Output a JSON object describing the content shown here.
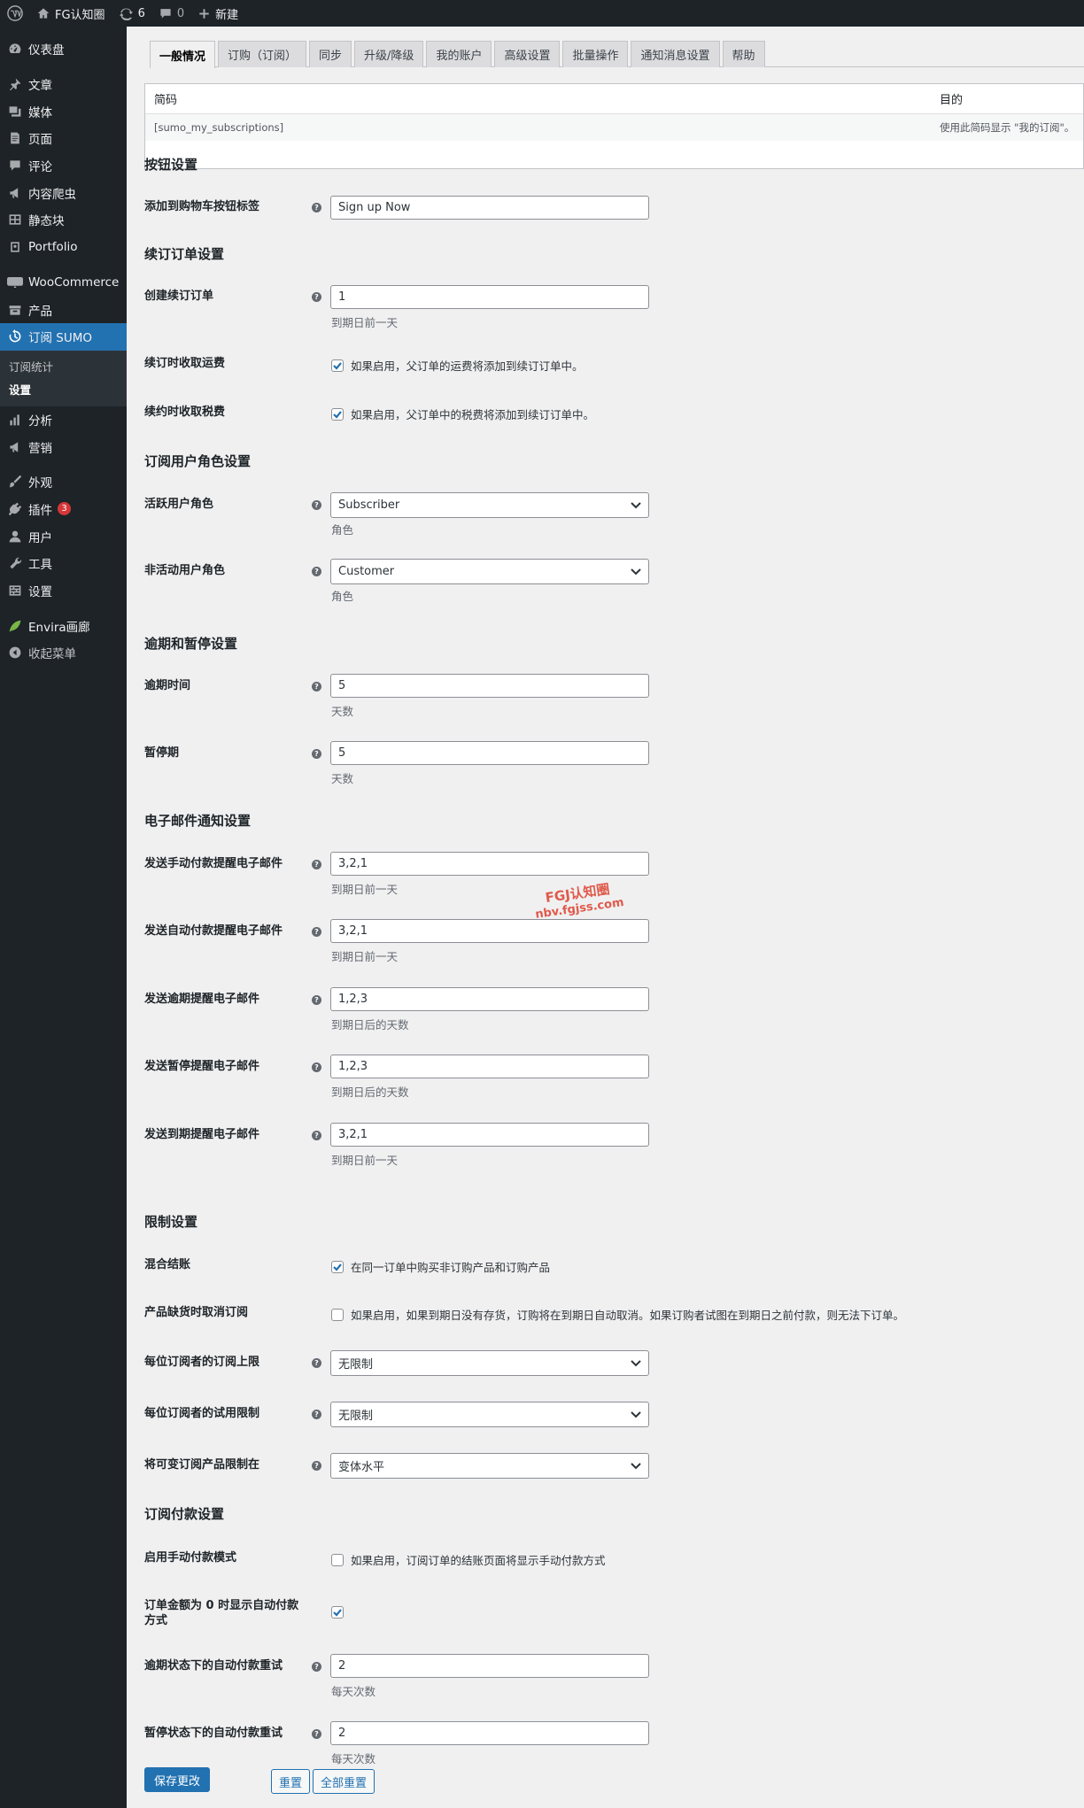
{
  "adminbar": {
    "site_name": "FG认知圈",
    "updates_count": "6",
    "comments_count": "0",
    "new_label": "新建"
  },
  "sidebar": {
    "items": [
      {
        "label": "仪表盘",
        "icon": "dashboard-icon"
      },
      {
        "label": "文章",
        "icon": "pin-icon"
      },
      {
        "label": "媒体",
        "icon": "media-icon"
      },
      {
        "label": "页面",
        "icon": "page-icon"
      },
      {
        "label": "评论",
        "icon": "comment-icon"
      },
      {
        "label": "内容爬虫",
        "icon": "megaphone-icon"
      },
      {
        "label": "静态块",
        "icon": "grid-icon"
      },
      {
        "label": "Portfolio",
        "icon": "portfolio-icon"
      },
      {
        "label": "WooCommerce",
        "icon": "woo-icon"
      },
      {
        "label": "产品",
        "icon": "archive-icon"
      },
      {
        "label": "订阅 SUMO",
        "icon": "history-icon"
      },
      {
        "label": "分析",
        "icon": "chart-icon"
      },
      {
        "label": "营销",
        "icon": "megaphone-icon"
      },
      {
        "label": "外观",
        "icon": "brush-icon"
      },
      {
        "label": "插件",
        "icon": "plugin-icon",
        "badge": "3"
      },
      {
        "label": "用户",
        "icon": "user-icon"
      },
      {
        "label": "工具",
        "icon": "wrench-icon"
      },
      {
        "label": "设置",
        "icon": "settings-icon"
      },
      {
        "label": "Envira画廊",
        "icon": "leaf-icon"
      },
      {
        "label": "收起菜单",
        "icon": "collapse-icon"
      }
    ],
    "submenu": [
      "订阅统计",
      "设置"
    ]
  },
  "tabs": [
    "一般情况",
    "订购（订阅）",
    "同步",
    "升级/降级",
    "我的账户",
    "高级设置",
    "批量操作",
    "通知消息设置",
    "帮助"
  ],
  "shortcode_table": {
    "col1": "简码",
    "col2": "目的",
    "row_code": "[sumo_my_subscriptions]",
    "row_purpose": "使用此简码显示 \"我的订阅\"。"
  },
  "sections": {
    "button": "按钮设置",
    "renewal": "续订订单设置",
    "roles": "订阅用户角色设置",
    "overdue": "逾期和暂停设置",
    "email": "电子邮件通知设置",
    "restrict": "限制设置",
    "payment": "订阅付款设置"
  },
  "fields": {
    "cart_label": {
      "label": "添加到购物车按钮标签",
      "value": "Sign up Now"
    },
    "create_renewal": {
      "label": "创建续订订单",
      "value": "1",
      "desc": "到期日前一天"
    },
    "renewal_shipping": {
      "label": "续订时收取运费",
      "check_text": "如果启用，父订单的运费将添加到续订订单中。",
      "checked": true
    },
    "renewal_tax": {
      "label": "续约时收取税费",
      "check_text": "如果启用，父订单中的税费将添加到续订订单中。",
      "checked": true
    },
    "active_role": {
      "label": "活跃用户角色",
      "value": "Subscriber",
      "desc": "角色"
    },
    "inactive_role": {
      "label": "非活动用户角色",
      "value": "Customer",
      "desc": "角色"
    },
    "overdue_time": {
      "label": "逾期时间",
      "value": "5",
      "desc": "天数"
    },
    "suspend_period": {
      "label": "暂停期",
      "value": "5",
      "desc": "天数"
    },
    "manual_reminder": {
      "label": "发送手动付款提醒电子邮件",
      "value": "3,2,1",
      "desc": "到期日前一天"
    },
    "auto_reminder": {
      "label": "发送自动付款提醒电子邮件",
      "value": "3,2,1",
      "desc": "到期日前一天"
    },
    "overdue_reminder": {
      "label": "发送逾期提醒电子邮件",
      "value": "1,2,3",
      "desc": "到期日后的天数"
    },
    "suspend_reminder": {
      "label": "发送暂停提醒电子邮件",
      "value": "1,2,3",
      "desc": "到期日后的天数"
    },
    "expiry_reminder": {
      "label": "发送到期提醒电子邮件",
      "value": "3,2,1",
      "desc": "到期日前一天"
    },
    "mixed_checkout": {
      "label": "混合结账",
      "check_text": "在同一订单中购买非订购产品和订购产品",
      "checked": true
    },
    "out_of_stock_cancel": {
      "label": "产品缺货时取消订阅",
      "check_text": "如果启用，如果到期日没有存货，订购将在到期日自动取消。如果订购者试图在到期日之前付款，则无法下订单。",
      "checked": false
    },
    "sub_limit": {
      "label": "每位订阅者的订阅上限",
      "value": "无限制"
    },
    "trial_limit": {
      "label": "每位订阅者的试用限制",
      "value": "无限制"
    },
    "variable_limit": {
      "label": "将可变订阅产品限制在",
      "value": "变体水平"
    },
    "manual_mode": {
      "label": "启用手动付款模式",
      "check_text": "如果启用，订阅订单的结账页面将显示手动付款方式",
      "checked": false
    },
    "zero_auto": {
      "label": "订单金额为 0 时显示自动付款方式",
      "checked": true
    },
    "overdue_retry": {
      "label": "逾期状态下的自动付款重试",
      "value": "2",
      "desc": "每天次数"
    },
    "suspend_retry": {
      "label": "暂停状态下的自动付款重试",
      "value": "2",
      "desc": "每天次数"
    }
  },
  "buttons": {
    "save": "保存更改",
    "reset": "重置",
    "reset_all": "全部重置"
  },
  "watermark": {
    "line1": "FGJ认知圈",
    "line2": "nbv.fgjss.com"
  }
}
